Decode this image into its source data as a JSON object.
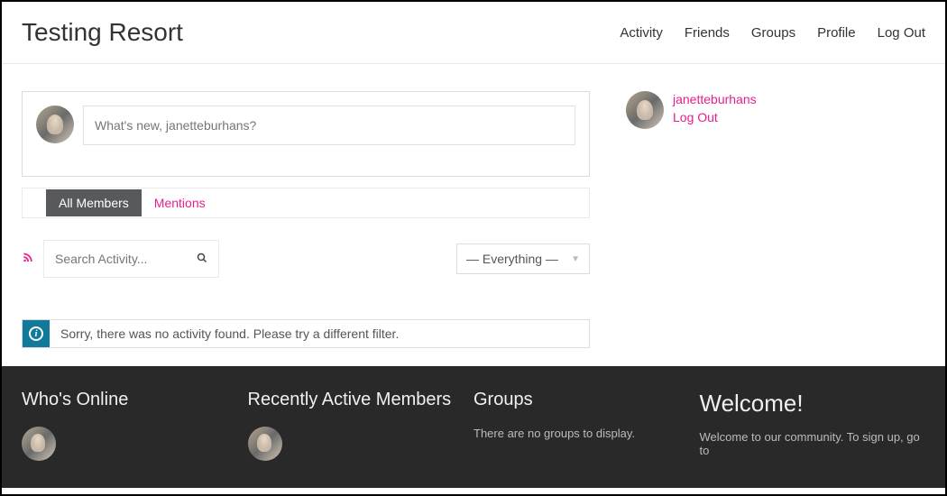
{
  "header": {
    "title": "Testing Resort",
    "nav": [
      "Activity",
      "Friends",
      "Groups",
      "Profile",
      "Log Out"
    ]
  },
  "post": {
    "placeholder": "What's new, janetteburhans?"
  },
  "tabs": {
    "active": "All Members",
    "inactive": "Mentions"
  },
  "filter": {
    "search_placeholder": "Search Activity...",
    "dropdown": "— Everything —"
  },
  "info": {
    "message": "Sorry, there was no activity found. Please try a different filter."
  },
  "sidebar": {
    "username": "janetteburhans",
    "logout": "Log Out"
  },
  "footer": {
    "col1_title": "Who's Online",
    "col2_title": "Recently Active Members",
    "col3_title": "Groups",
    "col3_text": "There are no groups to display.",
    "col4_title": "Welcome!",
    "col4_text": "Welcome to our community. To sign up, go to"
  }
}
